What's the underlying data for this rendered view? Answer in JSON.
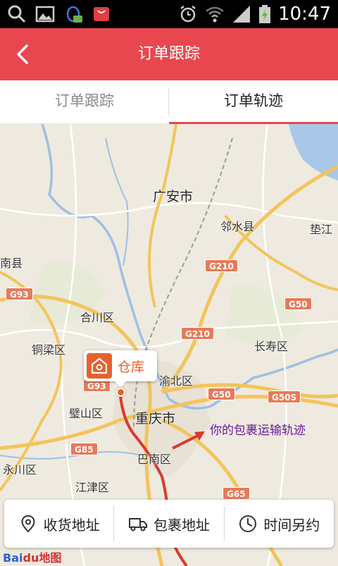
{
  "status_bar": {
    "time": "10:47"
  },
  "header": {
    "title": "订单跟踪"
  },
  "tabs": [
    {
      "label": "订单跟踪",
      "active": false
    },
    {
      "label": "订单轨迹",
      "active": true
    }
  ],
  "map": {
    "places": [
      "广安市",
      "邻水县",
      "垫江",
      "南县",
      "合川区",
      "铜梁区",
      "长寿区",
      "渝北区",
      "璧山区",
      "重庆市",
      "巴南区",
      "永川区",
      "江津区"
    ],
    "highways": [
      "G210",
      "G93",
      "G50",
      "G210",
      "G93",
      "G50",
      "G50S",
      "G85",
      "G65"
    ],
    "warehouse_label": "仓库",
    "annotation": "你的包裹运输轨迹",
    "logo": "Baidu地图"
  },
  "actions": [
    {
      "label": "收货地址",
      "icon": "location-pin-icon"
    },
    {
      "label": "包裹地址",
      "icon": "truck-icon"
    },
    {
      "label": "时间另约",
      "icon": "clock-icon"
    }
  ],
  "colors": {
    "accent": "#e9474f",
    "marker": "#e8602b",
    "annotation": "#6a1a9a"
  }
}
